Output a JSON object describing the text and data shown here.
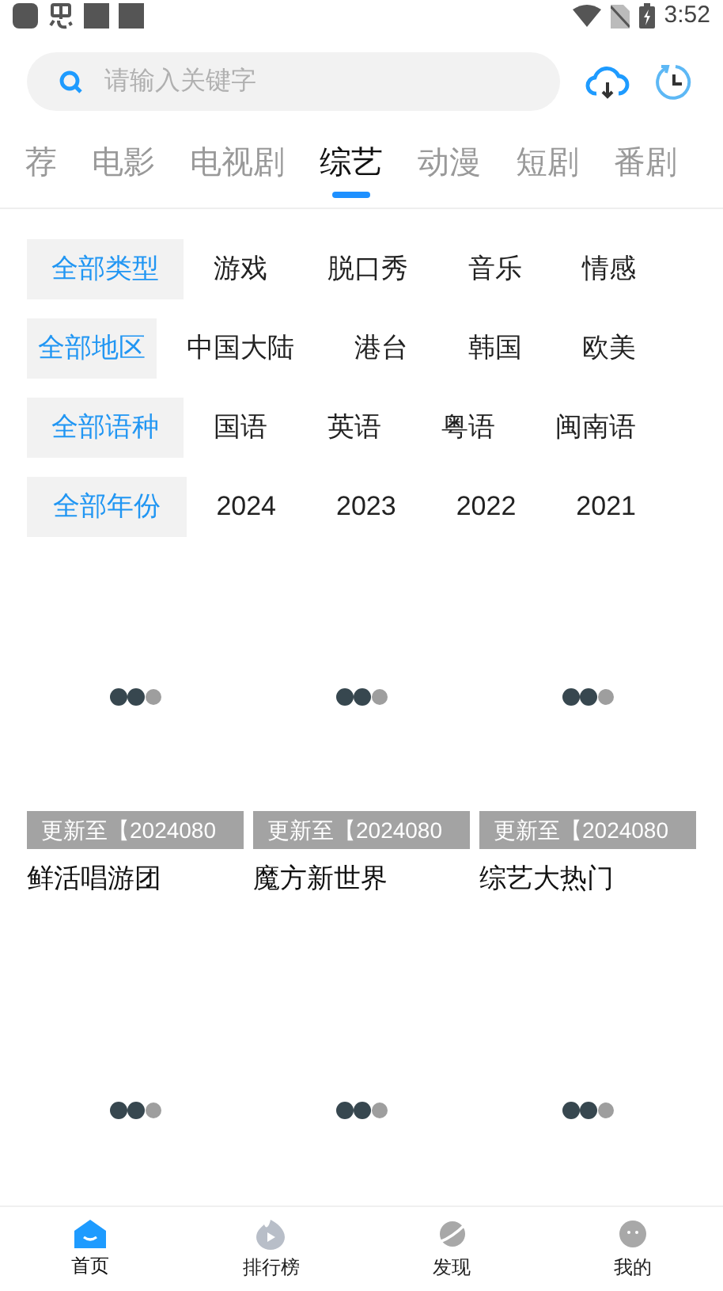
{
  "status_bar": {
    "time": "3:52"
  },
  "search": {
    "placeholder": "请输入关键字"
  },
  "tabs": [
    {
      "label": "荐",
      "selected": false
    },
    {
      "label": "电影",
      "selected": false
    },
    {
      "label": "电视剧",
      "selected": false
    },
    {
      "label": "综艺",
      "selected": true
    },
    {
      "label": "动漫",
      "selected": false
    },
    {
      "label": "短剧",
      "selected": false
    },
    {
      "label": "番剧",
      "selected": false
    }
  ],
  "filters": [
    [
      {
        "label": "全部类型",
        "selected": true
      },
      {
        "label": "游戏",
        "selected": false
      },
      {
        "label": "脱口秀",
        "selected": false
      },
      {
        "label": "音乐",
        "selected": false
      },
      {
        "label": "情感",
        "selected": false
      }
    ],
    [
      {
        "label": "全部地区",
        "selected": true
      },
      {
        "label": "中国大陆",
        "selected": false
      },
      {
        "label": "港台",
        "selected": false
      },
      {
        "label": "韩国",
        "selected": false
      },
      {
        "label": "欧美",
        "selected": false
      }
    ],
    [
      {
        "label": "全部语种",
        "selected": true
      },
      {
        "label": "国语",
        "selected": false
      },
      {
        "label": "英语",
        "selected": false
      },
      {
        "label": "粤语",
        "selected": false
      },
      {
        "label": "闽南语",
        "selected": false
      }
    ],
    [
      {
        "label": "全部年份",
        "selected": true
      },
      {
        "label": "2024",
        "selected": false
      },
      {
        "label": "2023",
        "selected": false
      },
      {
        "label": "2022",
        "selected": false
      },
      {
        "label": "2021",
        "selected": false
      }
    ]
  ],
  "cards": [
    {
      "kind": "titled",
      "update": "更新至【2024080",
      "title": "鲜活唱游团"
    },
    {
      "kind": "titled",
      "update": "更新至【2024080",
      "title": "魔方新世界"
    },
    {
      "kind": "titled",
      "update": "更新至【2024080",
      "title": "综艺大热门"
    },
    {
      "kind": "loading"
    },
    {
      "kind": "loading"
    },
    {
      "kind": "loading"
    }
  ],
  "bottom_nav": [
    {
      "label": "首页",
      "selected": true,
      "kind": "home"
    },
    {
      "label": "排行榜",
      "selected": false,
      "kind": "rank"
    },
    {
      "label": "发现",
      "selected": false,
      "kind": "discover"
    },
    {
      "label": "我的",
      "selected": false,
      "kind": "me"
    }
  ]
}
